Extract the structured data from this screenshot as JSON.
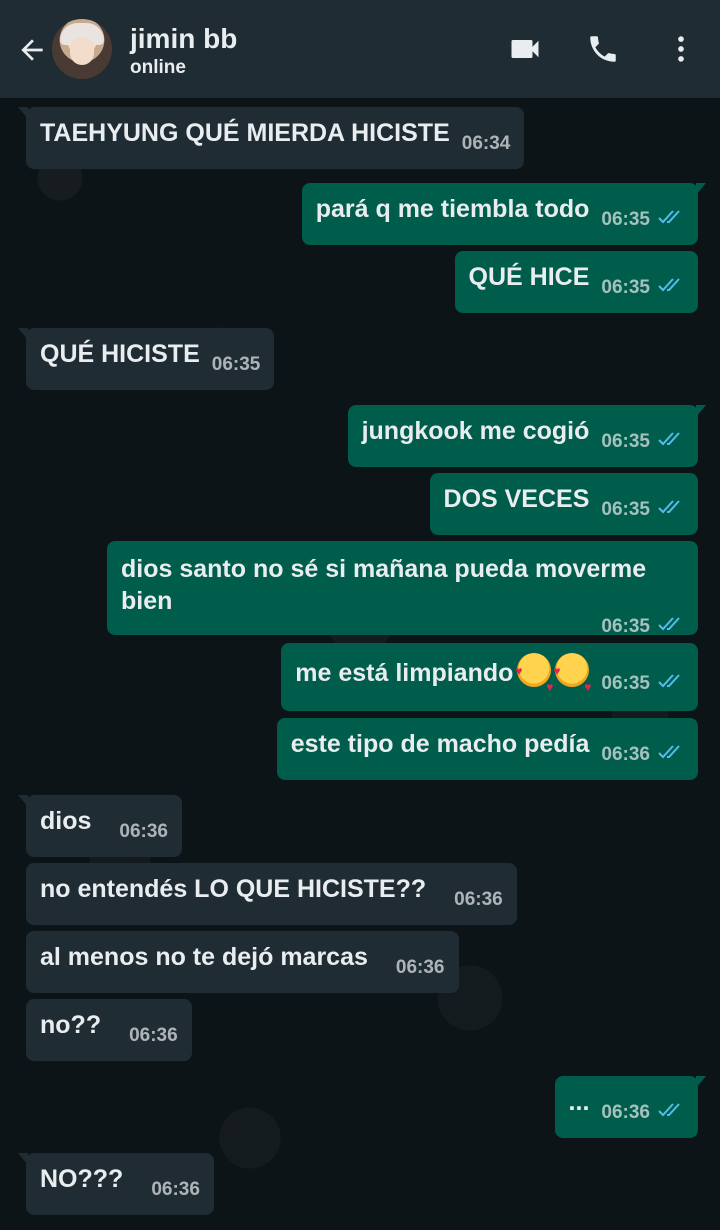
{
  "header": {
    "contact_name": "jimin bb",
    "status": "online",
    "icons": {
      "back": "back-arrow-icon",
      "video": "video-call-icon",
      "call": "phone-icon",
      "menu": "more-vert-icon"
    }
  },
  "colors": {
    "header_bg": "#1f2c34",
    "chat_bg": "#0d1418",
    "incoming_bubble": "#1f2c34",
    "outgoing_bubble": "#005c4b",
    "read_tick": "#53bdeb"
  },
  "messages": [
    {
      "dir": "in",
      "text": "TAEHYUNG QUÉ MIERDA HICISTE",
      "time": "06:34"
    },
    {
      "dir": "out",
      "text": "pará q me tiembla todo",
      "time": "06:35",
      "read": true
    },
    {
      "dir": "out",
      "text": "QUÉ HICE",
      "time": "06:35",
      "read": true
    },
    {
      "dir": "in",
      "text": "QUÉ HICISTE",
      "time": "06:35"
    },
    {
      "dir": "out",
      "text": "jungkook me cogió",
      "time": "06:35",
      "read": true
    },
    {
      "dir": "out",
      "text": "DOS VECES",
      "time": "06:35",
      "read": true
    },
    {
      "dir": "out",
      "text": "dios santo no sé si mañana pueda moverme bien",
      "time": "06:35",
      "read": true
    },
    {
      "dir": "out",
      "text": "me está limpiando",
      "emoji": "smiling-face-with-hearts-icon x2",
      "time": "06:35",
      "read": true
    },
    {
      "dir": "out",
      "text": "este tipo de macho pedía",
      "time": "06:36",
      "read": true
    },
    {
      "dir": "in",
      "text": "dios",
      "time": "06:36"
    },
    {
      "dir": "in",
      "text": "no entendés LO QUE HICISTE??",
      "time": "06:36"
    },
    {
      "dir": "in",
      "text": "al menos no te dejó marcas",
      "time": "06:36"
    },
    {
      "dir": "in",
      "text": "no??",
      "time": "06:36"
    },
    {
      "dir": "out",
      "text": "...",
      "time": "06:36",
      "read": true
    },
    {
      "dir": "in",
      "text": "NO???",
      "time": "06:36"
    }
  ]
}
